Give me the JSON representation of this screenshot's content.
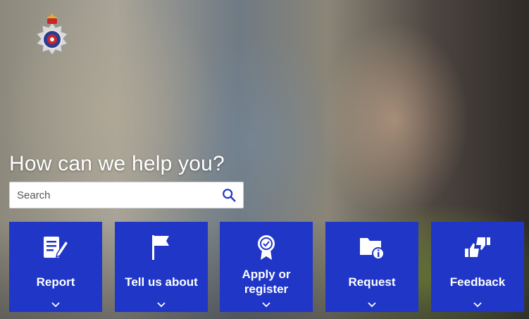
{
  "hero": {
    "headline": "How can we help you?",
    "logo_icon": "police-crest-icon"
  },
  "search": {
    "placeholder": "Search",
    "value": "",
    "icon": "search-icon"
  },
  "tiles": [
    {
      "label": "Report",
      "icon": "report-form-icon"
    },
    {
      "label": "Tell us about",
      "icon": "flag-icon"
    },
    {
      "label": "Apply or register",
      "icon": "award-rosette-icon"
    },
    {
      "label": "Request",
      "icon": "folder-info-icon"
    },
    {
      "label": "Feedback",
      "icon": "thumbs-up-down-icon"
    }
  ],
  "colors": {
    "tile_background": "#1f36c7",
    "tile_text": "#ffffff",
    "search_icon": "#1f36c7"
  }
}
